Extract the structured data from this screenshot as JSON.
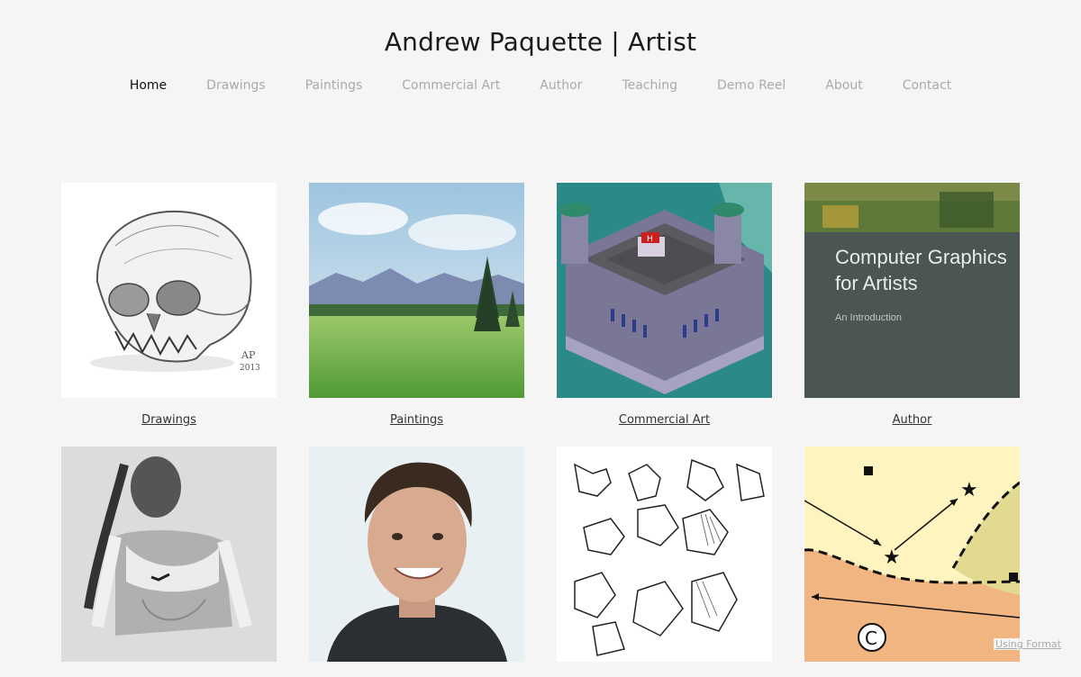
{
  "site": {
    "title": "Andrew Paquette | Artist"
  },
  "nav": {
    "items": [
      {
        "label": "Home",
        "active": true
      },
      {
        "label": "Drawings"
      },
      {
        "label": "Paintings"
      },
      {
        "label": "Commercial Art"
      },
      {
        "label": "Author"
      },
      {
        "label": "Teaching"
      },
      {
        "label": "Demo Reel"
      },
      {
        "label": "About"
      },
      {
        "label": "Contact"
      }
    ]
  },
  "gallery": {
    "tiles": [
      {
        "caption": "Drawings",
        "image": "skull-drawing"
      },
      {
        "caption": "Paintings",
        "image": "landscape-painting"
      },
      {
        "caption": "Commercial Art",
        "image": "isometric-castle"
      },
      {
        "caption": "Author",
        "image": "book-cover",
        "book_title_line1": "Computer Graphics",
        "book_title_line2": "for Artists",
        "book_subtitle": "An Introduction"
      },
      {
        "caption": "",
        "image": "figure-drawing"
      },
      {
        "caption": "",
        "image": "portrait-photo"
      },
      {
        "caption": "",
        "image": "hand-sketches"
      },
      {
        "caption": "",
        "image": "diagram",
        "diagram_label": "C"
      }
    ]
  },
  "footer": {
    "link": "Using Format"
  }
}
